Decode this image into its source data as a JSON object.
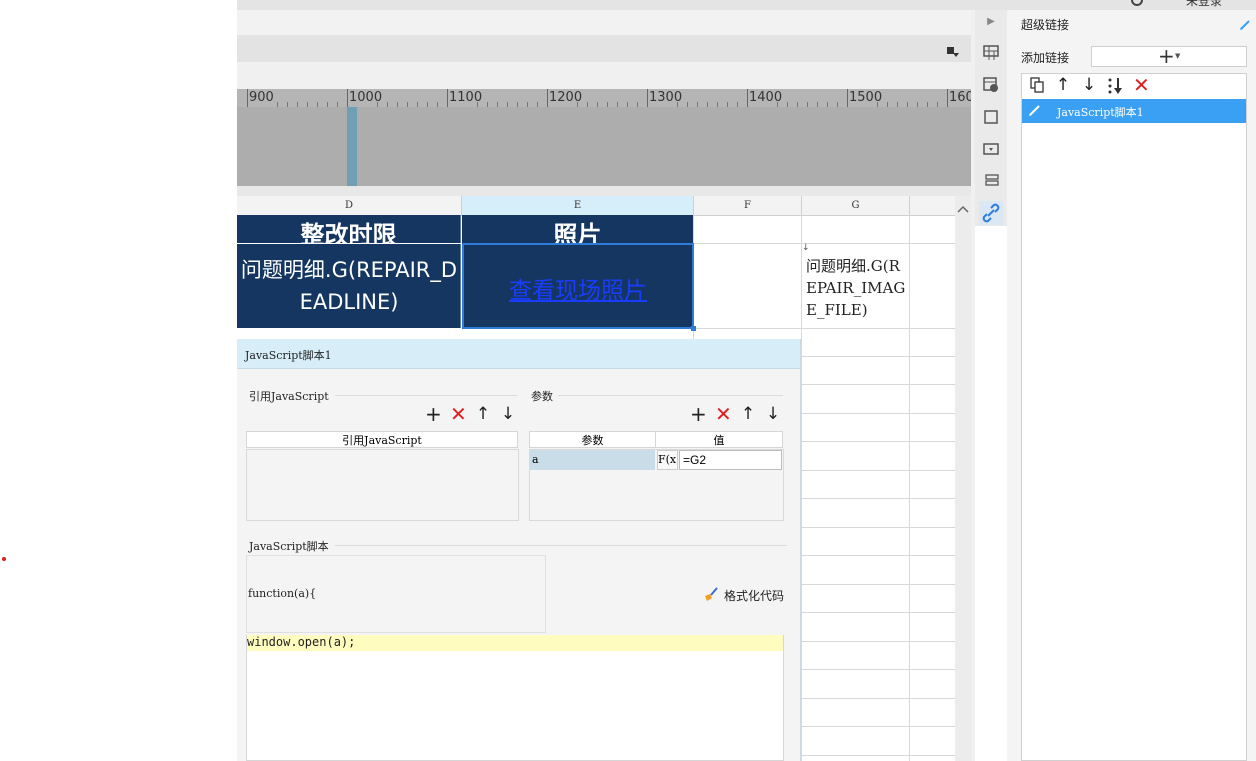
{
  "top_right_text": "未登录",
  "ruler": {
    "labels": [
      "900",
      "1000",
      "1100",
      "1200",
      "1300",
      "1400",
      "1500",
      "160"
    ]
  },
  "sheet": {
    "columns": [
      "D",
      "E",
      "F",
      "G"
    ],
    "header_row": {
      "d": "整改时限",
      "e": "照片"
    },
    "row2": {
      "d": "问题明细.G(REPAIR_DEADLINE)",
      "e_link": "查看现场照片",
      "g": "问题明细.G(REPAIR_IMAGE_FILE)"
    }
  },
  "js_panel": {
    "title": "JavaScript脚本1",
    "ref_section_label": "引用JavaScript",
    "ref_table_header": "引用JavaScript",
    "params_section_label": "参数",
    "params_table": {
      "headers": [
        "参数",
        "值"
      ],
      "rows": [
        {
          "name": "a",
          "fx": "F(x)",
          "value": "=G2"
        }
      ]
    },
    "script_section_label": "JavaScript脚本",
    "function_signature": "function(a){",
    "format_button": "格式化代码",
    "code_line": "window.open(a);"
  },
  "right_panel": {
    "title": "超级链接",
    "add_link_label": "添加链接",
    "links": [
      {
        "label": "JavaScript脚本1",
        "selected": true
      }
    ]
  },
  "colors": {
    "navy": "#143660",
    "accent_blue": "#3aa0f3",
    "selection_border": "#2e7bd8",
    "code_highlight": "#fffcc0"
  }
}
